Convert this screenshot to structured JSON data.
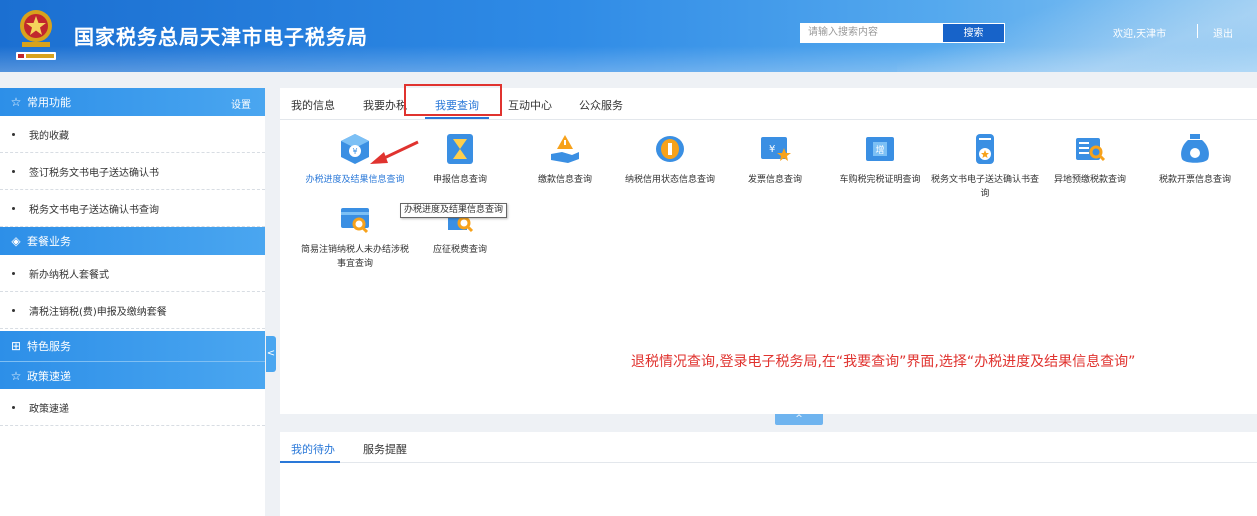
{
  "header": {
    "title": "国家税务总局天津市电子税务局",
    "search_placeholder": "请输入搜索内容",
    "search_label": "搜索",
    "welcome": "欢迎,天津市",
    "logout": "退出"
  },
  "sidebar": {
    "sections": [
      {
        "title": "常用功能",
        "icon": "star-outline-icon",
        "extra": "设置",
        "items": [
          "我的收藏",
          "签订税务文书电子送达确认书",
          "税务文书电子送达确认书查询"
        ]
      },
      {
        "title": "套餐业务",
        "icon": "layers-icon",
        "items": [
          "新办纳税人套餐式",
          "清税注销税(费)申报及缴纳套餐"
        ]
      },
      {
        "title": "特色服务",
        "icon": "grid-icon",
        "items": []
      },
      {
        "title": "政策速递",
        "icon": "star-outline-icon",
        "items": [
          "政策速递"
        ]
      }
    ],
    "collapse": "<"
  },
  "tabs": [
    {
      "label": "我的信息"
    },
    {
      "label": "我要办税"
    },
    {
      "label": "我要查询",
      "active": true
    },
    {
      "label": "互动中心"
    },
    {
      "label": "公众服务"
    }
  ],
  "query_items": [
    {
      "label": "办税进度及结果信息查询",
      "icon": "progress-box-icon"
    },
    {
      "label": "申报信息查询",
      "icon": "hourglass-icon"
    },
    {
      "label": "缴款信息查询",
      "icon": "payment-hand-icon"
    },
    {
      "label": "纳税信用状态信息查询",
      "icon": "credit-coin-icon"
    },
    {
      "label": "发票信息查询",
      "icon": "invoice-star-icon"
    },
    {
      "label": "车购税完税证明查询",
      "icon": "vat-ticket-icon"
    },
    {
      "label": "税务文书电子送达确认书查询",
      "icon": "document-badge-icon"
    },
    {
      "label": "异地预缴税款查询",
      "icon": "list-search-icon"
    },
    {
      "label": "税款开票信息查询",
      "icon": "money-bag-icon"
    },
    {
      "label": "简易注销纳税人未办结涉税事宜查询",
      "icon": "card-search-icon"
    },
    {
      "label": "应征税费查询",
      "icon": "tax-search-icon"
    }
  ],
  "tooltip": "办税进度及结果信息查询",
  "annotation": "退税情况查询,登录电子税务局,在“我要查询”界面,选择“办税进度及结果信息查询”",
  "expand": "^",
  "bottom_tabs": [
    {
      "label": "我的待办",
      "active": true
    },
    {
      "label": "服务提醒"
    }
  ],
  "colors": {
    "accent": "#2a78d8",
    "highlight": "#e0332f",
    "header": "#1b6fd1"
  }
}
